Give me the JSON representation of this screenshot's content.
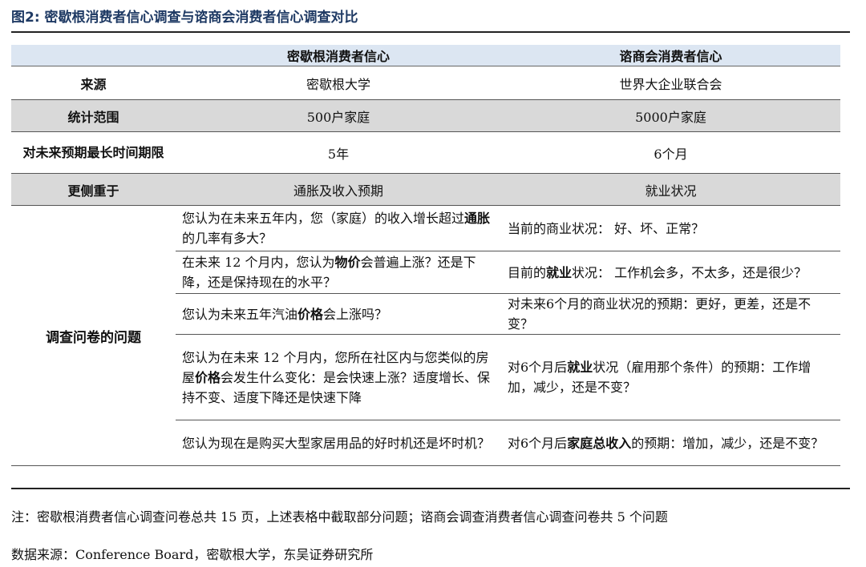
{
  "figure": {
    "title": "图2:  密歇根消费者信心调查与谘商会消费者信心调查对比"
  },
  "table": {
    "header": [
      "",
      "密歇根消费者信心",
      "谘商会消费者信心"
    ],
    "rows": [
      {
        "label": "来源",
        "michigan": "密歇根大学",
        "conference": "世界大企业联合会"
      },
      {
        "label": "统计范围",
        "michigan": "500户家庭",
        "conference": "5000户家庭"
      },
      {
        "label": "对未来预期最长时间期限",
        "michigan": "5年",
        "conference": "6个月"
      },
      {
        "label": "更侧重于",
        "michigan": "通胀及收入预期",
        "conference": "就业状况"
      }
    ],
    "questions_label": "调查问卷的问题",
    "questions": [
      {
        "michigan": {
          "pre": "您认为在未来五年内，您（家庭）的收入增长超过",
          "bold": "通胀",
          "post": "的几率有多大？"
        },
        "conference": {
          "pre": "当前的商业状况：  好、坏、正常？",
          "bold": "",
          "post": ""
        }
      },
      {
        "michigan": {
          "pre": "在未来 12 个月内，您认为",
          "bold": "物价",
          "post": "会普遍上涨？还是下降，还是保持现在的水平？"
        },
        "conference": {
          "pre": "目前的",
          "bold": "就业",
          "post": "状况：  工作机会多，不太多，还是很少？"
        }
      },
      {
        "michigan": {
          "pre": "您认为未来五年汽油",
          "bold": "价格",
          "post": "会上涨吗？"
        },
        "conference": {
          "pre": "对未来6个月的商业状况的预期：更好，更差，还是不变？",
          "bold": "",
          "post": ""
        }
      },
      {
        "michigan": {
          "pre": "您认为在未来 12 个月内，您所在社区内与您类似的房屋",
          "bold": "价格",
          "post": "会发生什么变化：是会快速上涨？适度增长、保持不变、适度下降还是快速下降"
        },
        "conference": {
          "pre": "对6个月后",
          "bold": "就业",
          "post": "状况（雇用那个条件）的预期：工作增加，减少，还是不变？"
        }
      },
      {
        "michigan": {
          "pre": "您认为现在是购买大型家居用品的好时机还是坏时机？",
          "bold": "",
          "post": ""
        },
        "conference": {
          "pre": "对6个月后",
          "bold": "家庭总收入",
          "post": "的预期：增加，减少，还是不变？"
        }
      }
    ]
  },
  "note": "注：密歇根消费者信心调查问卷总共 15 页，上述表格中截取部分问题；谘商会调查消费者信心调查问卷共 5 个问题",
  "source": "数据来源：Conference Board，密歇根大学，东吴证券研究所"
}
